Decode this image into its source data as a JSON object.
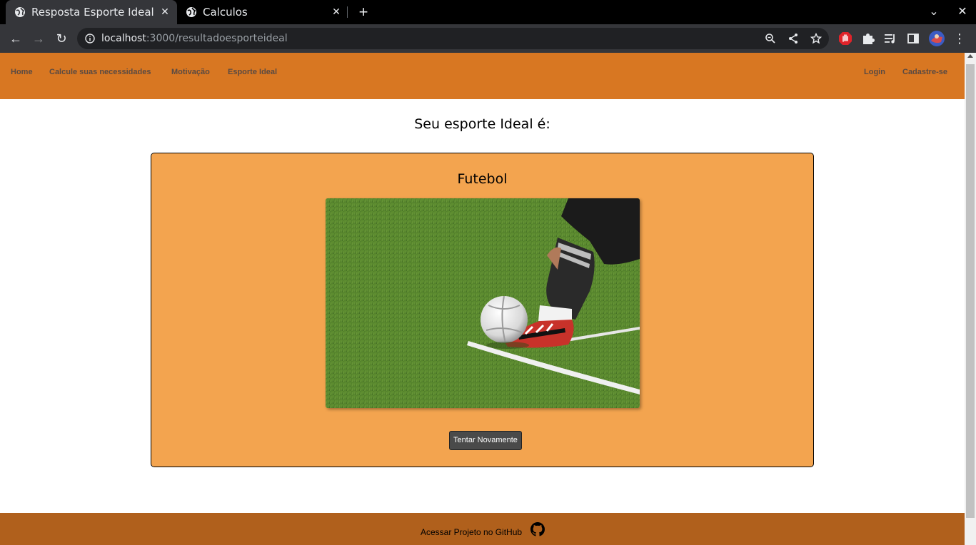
{
  "browser": {
    "tabs": [
      {
        "title": "Resposta Esporte Ideal",
        "active": true
      },
      {
        "title": "Calculos",
        "active": false
      }
    ],
    "url_host": "localhost",
    "url_path": ":3000/resultadoesporteideal"
  },
  "nav": {
    "left": [
      "Home",
      "Calcule suas necessidades",
      "Motivação",
      "Esporte Ideal"
    ],
    "right": [
      "Login",
      "Cadastre-se"
    ]
  },
  "page": {
    "heading": "Seu esporte Ideal é:",
    "sport_name": "Futebol",
    "retry_label": "Tentar Novamente"
  },
  "footer": {
    "text": "Acessar Projeto no GitHub"
  },
  "colors": {
    "nav_bg": "#d87722",
    "card_bg": "#f3a44f",
    "footer_bg": "#b0601c",
    "button_bg": "#4a4a4a"
  }
}
